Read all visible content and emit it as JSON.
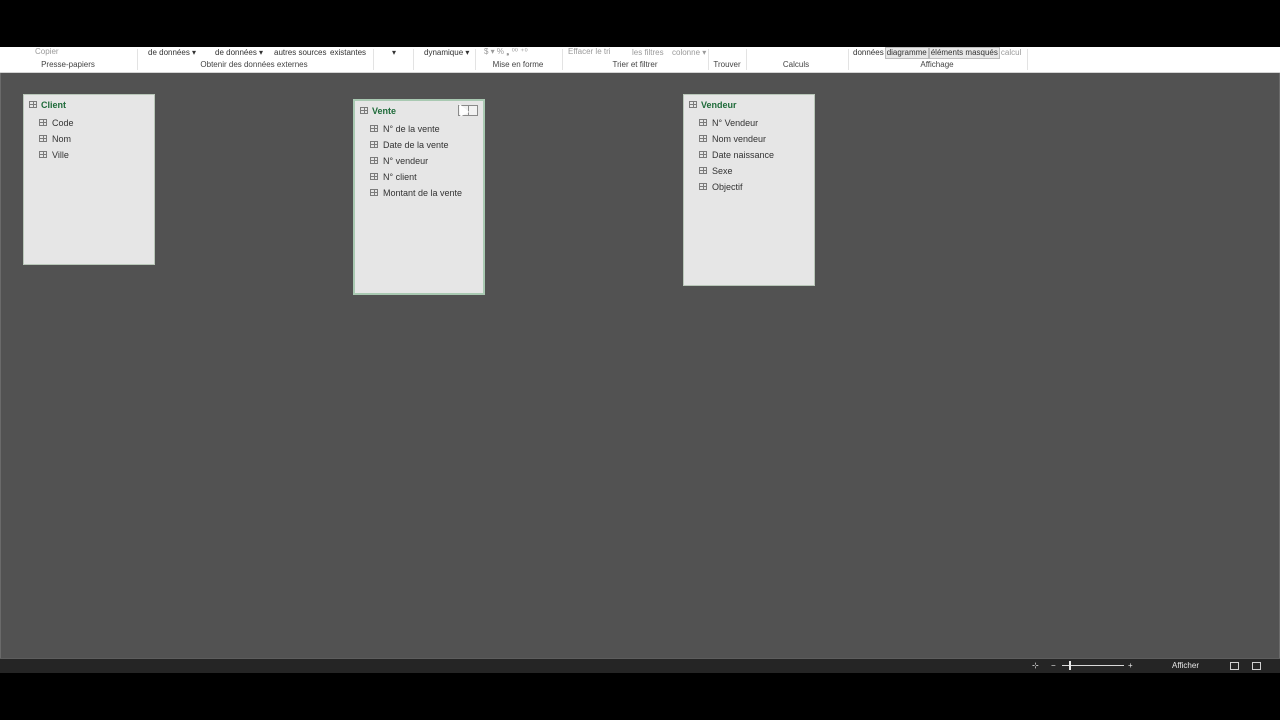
{
  "ribbon": {
    "commands": {
      "copy": "Copier",
      "db1": "de données ▾",
      "db2": "de données ▾",
      "other_sources": "autres sources",
      "existing": "existantes",
      "dropdown": "▾",
      "dynamic": "dynamique ▾",
      "number_format": "$ ▾ % ❟ ⁰⁰ ⁺⁰",
      "clear_sort": "Effacer le tri",
      "clear_filters": "les filtres",
      "column": "colonne ▾",
      "view_data": "données",
      "view_diagram": "diagramme",
      "view_hidden": "éléments masqués",
      "view_calc": "calcul"
    },
    "groups": {
      "clipboard": "Presse-papiers",
      "external": "Obtenir des données externes",
      "format": "Mise en forme",
      "sort_filter": "Trier et filtrer",
      "find": "Trouver",
      "calculations": "Calculs",
      "view": "Affichage"
    }
  },
  "tables": [
    {
      "title": "Client",
      "columns": [
        "Code",
        "Nom",
        "Ville"
      ]
    },
    {
      "title": "Vente",
      "columns": [
        "N° de la vente",
        "Date de la vente",
        "N° vendeur",
        "N° client",
        "Montant de la vente"
      ]
    },
    {
      "title": "Vendeur",
      "columns": [
        "N° Vendeur",
        "Nom vendeur",
        "Date naissance",
        "Sexe",
        "Objectif"
      ]
    }
  ],
  "statusbar": {
    "zoom_out": "−",
    "zoom_in": "+",
    "show_label": "Afficher"
  },
  "colors": {
    "canvas": "#525252",
    "table_title": "#1f6b3a",
    "status_bar": "#252525"
  }
}
